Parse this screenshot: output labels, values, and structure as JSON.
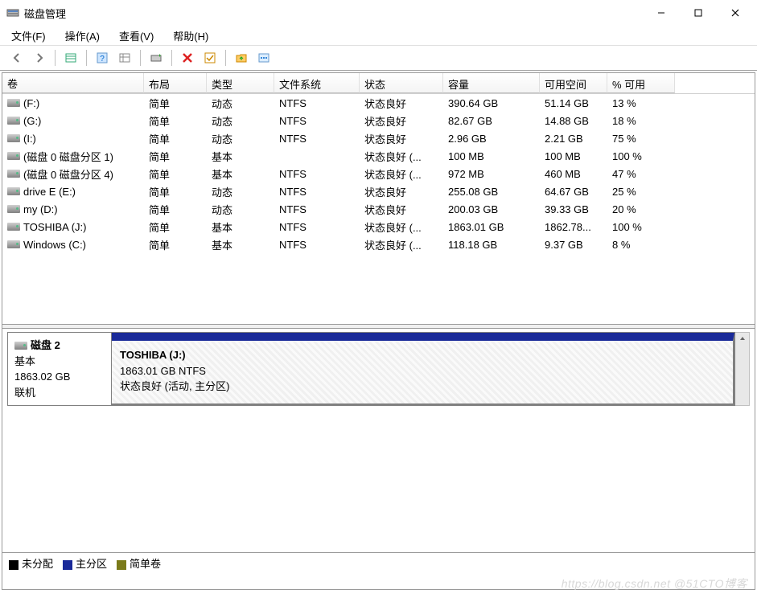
{
  "window": {
    "title": "磁盘管理",
    "minimize": "—",
    "maximize": "□",
    "close": "✕"
  },
  "menu": {
    "file": "文件(F)",
    "action": "操作(A)",
    "view": "查看(V)",
    "help": "帮助(H)"
  },
  "columns": {
    "volume": "卷",
    "layout": "布局",
    "type": "类型",
    "fs": "文件系统",
    "status": "状态",
    "capacity": "容量",
    "free": "可用空间",
    "percent": "% 可用"
  },
  "volumes": [
    {
      "name": "(F:)",
      "layout": "简单",
      "type": "动态",
      "fs": "NTFS",
      "status": "状态良好",
      "cap": "390.64 GB",
      "free": "51.14 GB",
      "pct": "13 %"
    },
    {
      "name": "(G:)",
      "layout": "简单",
      "type": "动态",
      "fs": "NTFS",
      "status": "状态良好",
      "cap": "82.67 GB",
      "free": "14.88 GB",
      "pct": "18 %"
    },
    {
      "name": "(I:)",
      "layout": "简单",
      "type": "动态",
      "fs": "NTFS",
      "status": "状态良好",
      "cap": "2.96 GB",
      "free": "2.21 GB",
      "pct": "75 %"
    },
    {
      "name": "(磁盘 0 磁盘分区 1)",
      "layout": "简单",
      "type": "基本",
      "fs": "",
      "status": "状态良好 (...",
      "cap": "100 MB",
      "free": "100 MB",
      "pct": "100 %"
    },
    {
      "name": "(磁盘 0 磁盘分区 4)",
      "layout": "简单",
      "type": "基本",
      "fs": "NTFS",
      "status": "状态良好 (...",
      "cap": "972 MB",
      "free": "460 MB",
      "pct": "47 %"
    },
    {
      "name": "drive E (E:)",
      "layout": "简单",
      "type": "动态",
      "fs": "NTFS",
      "status": "状态良好",
      "cap": "255.08 GB",
      "free": "64.67 GB",
      "pct": "25 %"
    },
    {
      "name": "my (D:)",
      "layout": "简单",
      "type": "动态",
      "fs": "NTFS",
      "status": "状态良好",
      "cap": "200.03 GB",
      "free": "39.33 GB",
      "pct": "20 %"
    },
    {
      "name": "TOSHIBA (J:)",
      "layout": "简单",
      "type": "基本",
      "fs": "NTFS",
      "status": "状态良好 (...",
      "cap": "1863.01 GB",
      "free": "1862.78...",
      "pct": "100 %"
    },
    {
      "name": "Windows (C:)",
      "layout": "简单",
      "type": "基本",
      "fs": "NTFS",
      "status": "状态良好 (...",
      "cap": "118.18 GB",
      "free": "9.37 GB",
      "pct": "8 %"
    }
  ],
  "disk": {
    "label": "磁盘 2",
    "type": "基本",
    "size": "1863.02 GB",
    "status": "联机"
  },
  "partition": {
    "name": "TOSHIBA  (J:)",
    "info": "1863.01 GB NTFS",
    "status": "状态良好 (活动, 主分区)"
  },
  "legend": {
    "unallocated": "未分配",
    "primary": "主分区",
    "simple": "简单卷"
  },
  "watermark": "https://blog.csdn.net @51CTO博客"
}
